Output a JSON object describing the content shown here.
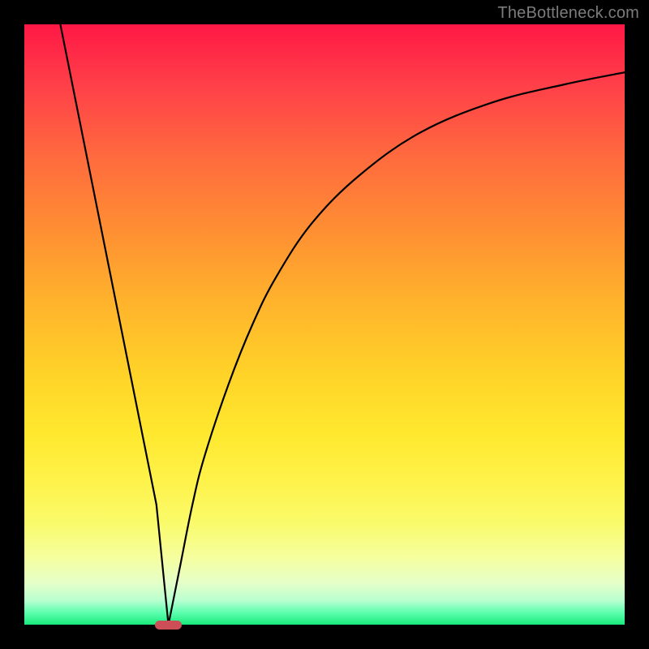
{
  "watermark": "TheBottleneck.com",
  "colors": {
    "frame_bg": "#000000",
    "watermark": "#7c7c7c",
    "curve_stroke": "#000000",
    "marker_fill": "#cc4f57",
    "gradient_top": "#ff1845",
    "gradient_bottom": "#18ea7a"
  },
  "chart_data": {
    "type": "line",
    "title": "",
    "xlabel": "",
    "ylabel": "",
    "xlim": [
      0,
      100
    ],
    "ylim": [
      0,
      100
    ],
    "grid": false,
    "legend": false,
    "annotations": [],
    "series": [
      {
        "name": "left-descent",
        "x": [
          6,
          10,
          14,
          18,
          22,
          24
        ],
        "values": [
          100,
          80,
          60,
          40,
          20,
          0
        ]
      },
      {
        "name": "right-ascent",
        "x": [
          24,
          26,
          28,
          30,
          34,
          38,
          42,
          48,
          56,
          66,
          78,
          90,
          100
        ],
        "values": [
          0,
          10,
          20,
          28,
          40,
          50,
          58,
          67,
          75,
          82,
          87,
          90,
          92
        ]
      }
    ],
    "marker": {
      "x": 24,
      "y": 0,
      "width_pct": 4.5
    }
  }
}
